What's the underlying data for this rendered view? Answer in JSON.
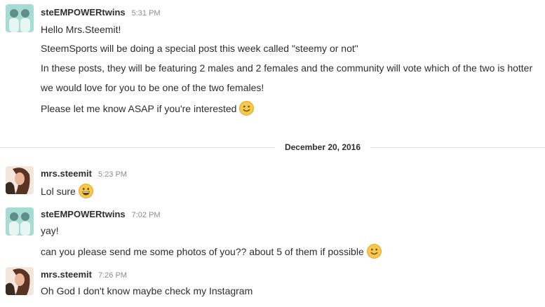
{
  "messages": [
    {
      "author": "steEMPOWERtwins",
      "time": "5:31 PM",
      "lines": [
        "Hello Mrs.Steemit!",
        "SteemSports will be doing a special post this week called \"steemy or not\"",
        "In these posts, they will be featuring 2 males and 2 females and the community will vote which of the two is hotter",
        "we would love for you to be one of the two females!",
        "Please let me know ASAP if you're interested"
      ],
      "emoji": "slightly-smiling-face"
    },
    {
      "author": "mrs.steemit",
      "time": "5:23 PM",
      "lines": [
        "Lol sure"
      ],
      "emoji": "grinning-face"
    },
    {
      "author": "steEMPOWERtwins",
      "time": "7:02 PM",
      "lines": [
        "yay!",
        "can you please send me some photos of you?? about 5 of them if possible"
      ],
      "emoji": "slightly-smiling-face"
    },
    {
      "author": "mrs.steemit",
      "time": "7:26 PM",
      "lines": [
        "Oh God I don't know maybe check my Instagram"
      ]
    }
  ],
  "date_divider": "December 20, 2016",
  "colors": {
    "text": "#2c2d30",
    "timestamp": "#8c8c8c",
    "divider": "#e1e1e1",
    "emoji_face": "#f7c84a",
    "avatar_twins": "#7fc8c0"
  }
}
